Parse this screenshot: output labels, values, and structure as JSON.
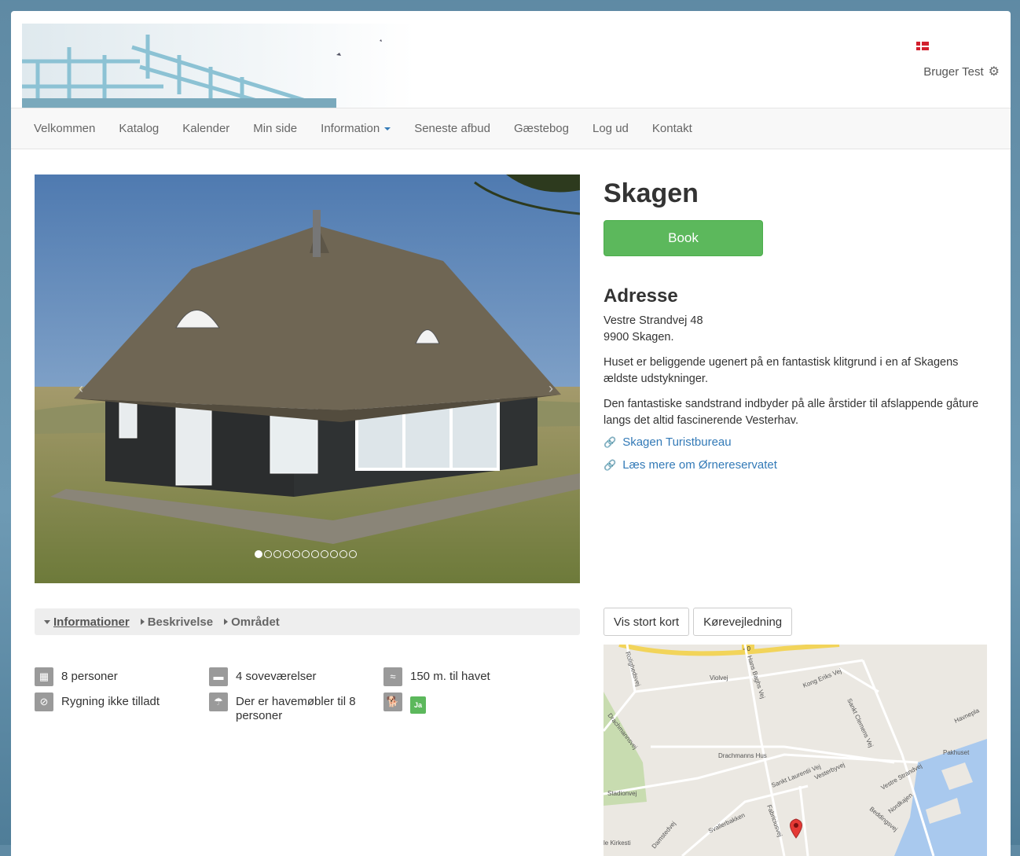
{
  "header": {
    "user_name": "Bruger Test",
    "flag_icon": "danish-flag-icon",
    "settings_icon": "gear-icon"
  },
  "nav": {
    "items": [
      "Velkommen",
      "Katalog",
      "Kalender",
      "Min side",
      "Information",
      "Seneste afbud",
      "Gæstebog",
      "Log ud",
      "Kontakt"
    ]
  },
  "carousel": {
    "dot_count": 11,
    "active_index": 0
  },
  "property": {
    "title": "Skagen",
    "book_label": "Book",
    "address_heading": "Adresse",
    "address_line1": "Vestre Strandvej 48",
    "address_line2": "9900 Skagen.",
    "description1": "Huset er beliggende ugenert på en fantastisk klitgrund i en af Skagens ældste udstykninger.",
    "description2": "Den fantastiske sandstrand indbyder på alle årstider til afslappende gåture langs det altid fascinerende Vesterhav.",
    "links": [
      "Skagen Turistbureau",
      "Læs mere om Ørnereservatet"
    ]
  },
  "tabs": {
    "items": [
      "Informationer",
      "Beskrivelse",
      "Området"
    ]
  },
  "features": {
    "persons": "8 personer",
    "bedrooms": "4 soveværelser",
    "distance_sea": "150 m. til havet",
    "smoking": "Rygning ikke tilladt",
    "garden_furniture": "Der er havemøbler til 8 personer",
    "pets_badge": "Ja"
  },
  "map": {
    "large_map_label": "Vis stort kort",
    "directions_label": "Kørevejledning",
    "labels": {
      "road40": "40",
      "rolighedsvej": "Rolighedsvej",
      "violvej": "Violvej",
      "hans_baghs_vej": "Hans Baghs Vej",
      "kong_eriks_vej": "Kong Eriks Vej",
      "drachmannsvej": "Drachmannsvej",
      "sankt_clemens_vej": "Sankt Clemens Vej",
      "havneplads": "Havnepla",
      "drachmanns_hus": "Drachmanns Hus",
      "sankt_laurentii_vej": "Sankt Laurentii Vej",
      "vesterbyvej": "Vesterbyvej",
      "vestre_strandvej": "Vestre Strandvej",
      "pakhuset": "Pakhuset",
      "stadionvej": "Stadionvej",
      "nordkajen": "Nordkajen",
      "beddingsvej": "Beddingsvej",
      "svallerbakken": "Svallerbakken",
      "fabriciusvej": "Fabriciusvej",
      "damstedvej": "Damstedvej",
      "kirkestien": "le Kirkesti"
    }
  }
}
